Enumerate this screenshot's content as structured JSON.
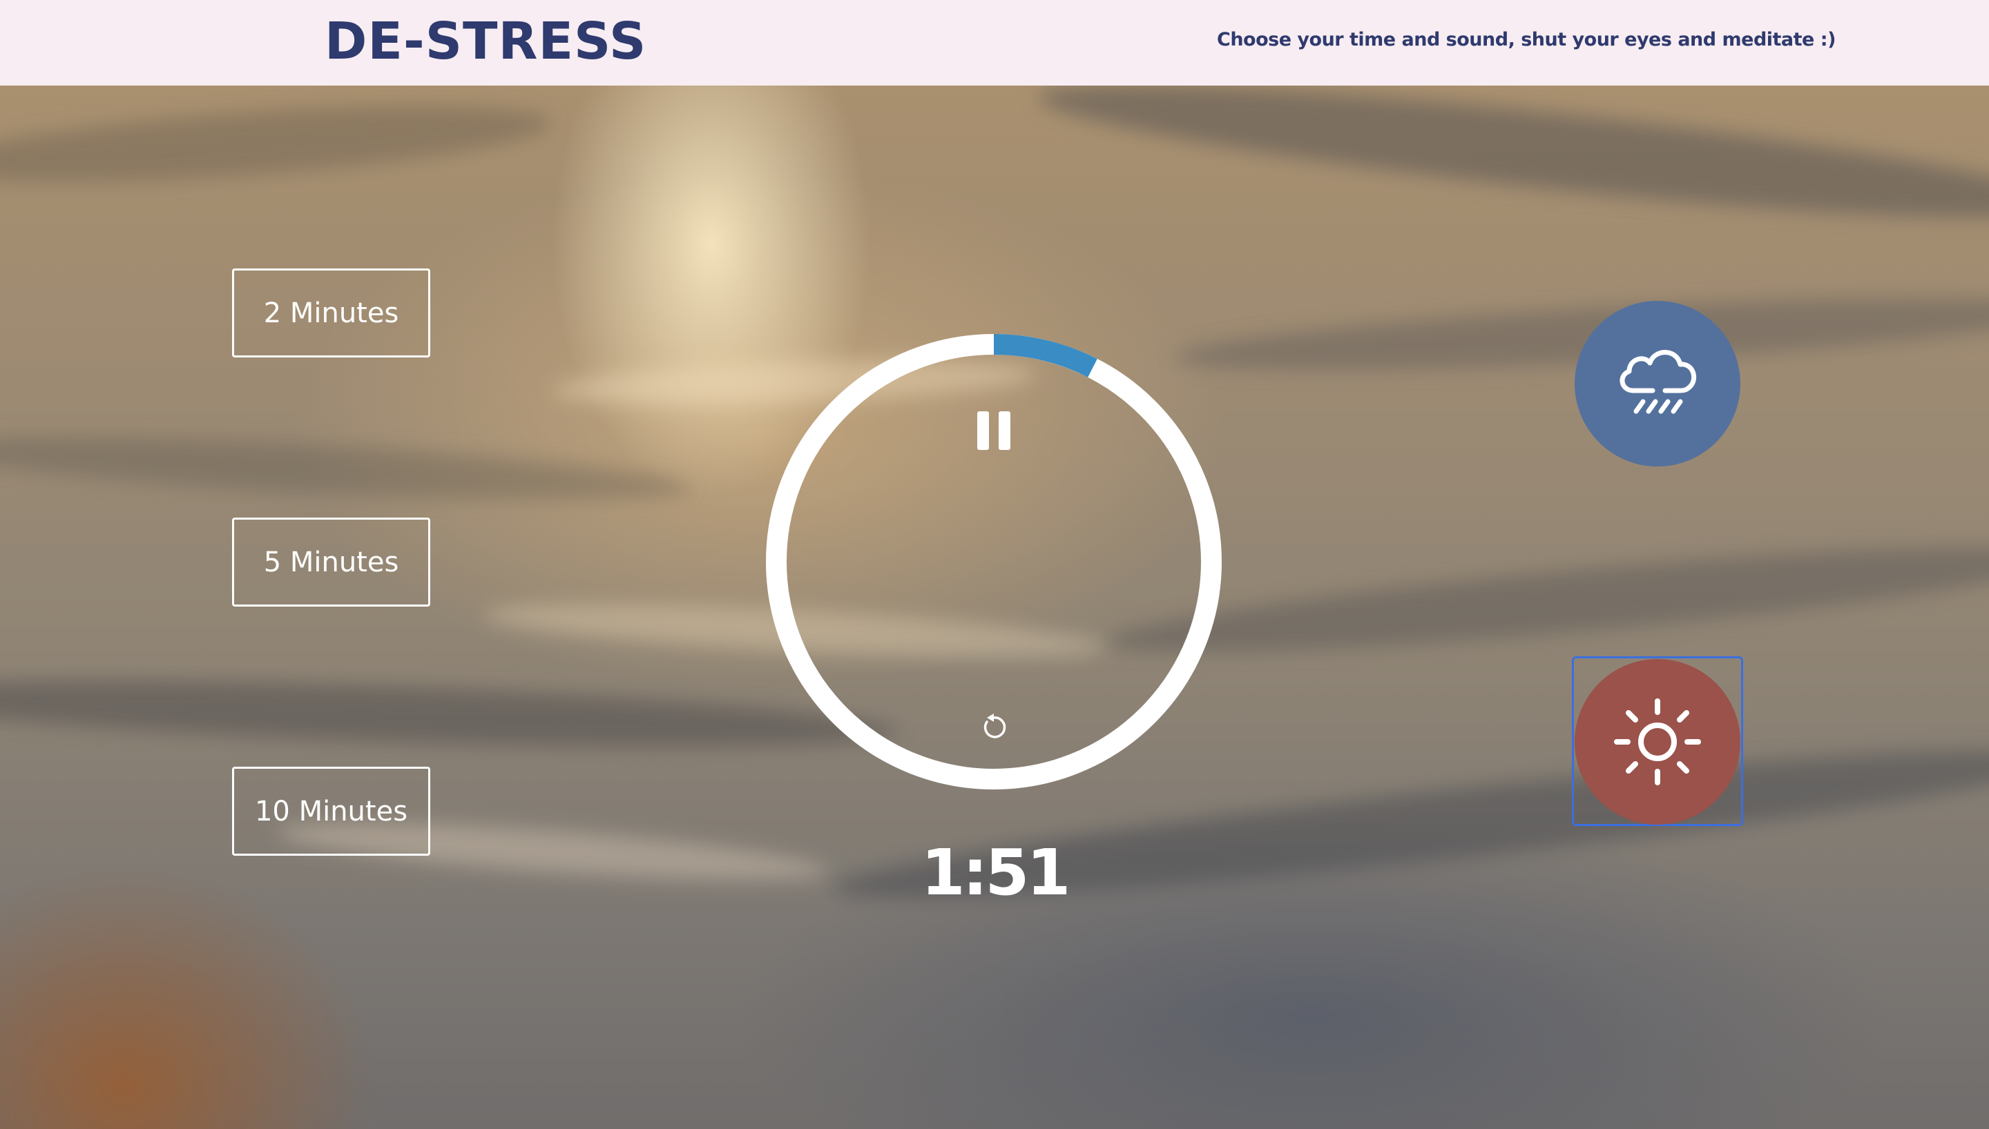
{
  "header": {
    "title": "DE-STRESS",
    "tagline": "Choose your time and sound, shut your eyes and meditate :)"
  },
  "time_options": [
    {
      "label": "2 Minutes"
    },
    {
      "label": "5 Minutes"
    },
    {
      "label": "10 Minutes"
    }
  ],
  "player": {
    "time_display": "1:51",
    "state": "playing",
    "play_pause_icon": "pause-icon",
    "replay_icon": "replay-icon",
    "progress_fraction": 0.075,
    "progress_color": "#3a8cc4",
    "track_color": "#ffffff"
  },
  "sounds": [
    {
      "name": "rain",
      "icon": "rain-cloud-icon",
      "color": "#54719e",
      "selected": false
    },
    {
      "name": "summer",
      "icon": "sun-icon",
      "color": "#9a524a",
      "selected": true
    }
  ],
  "colors": {
    "header_bg": "#f7edf2",
    "brand": "#2f3a6e",
    "focus_outline": "#3b6fe0"
  }
}
